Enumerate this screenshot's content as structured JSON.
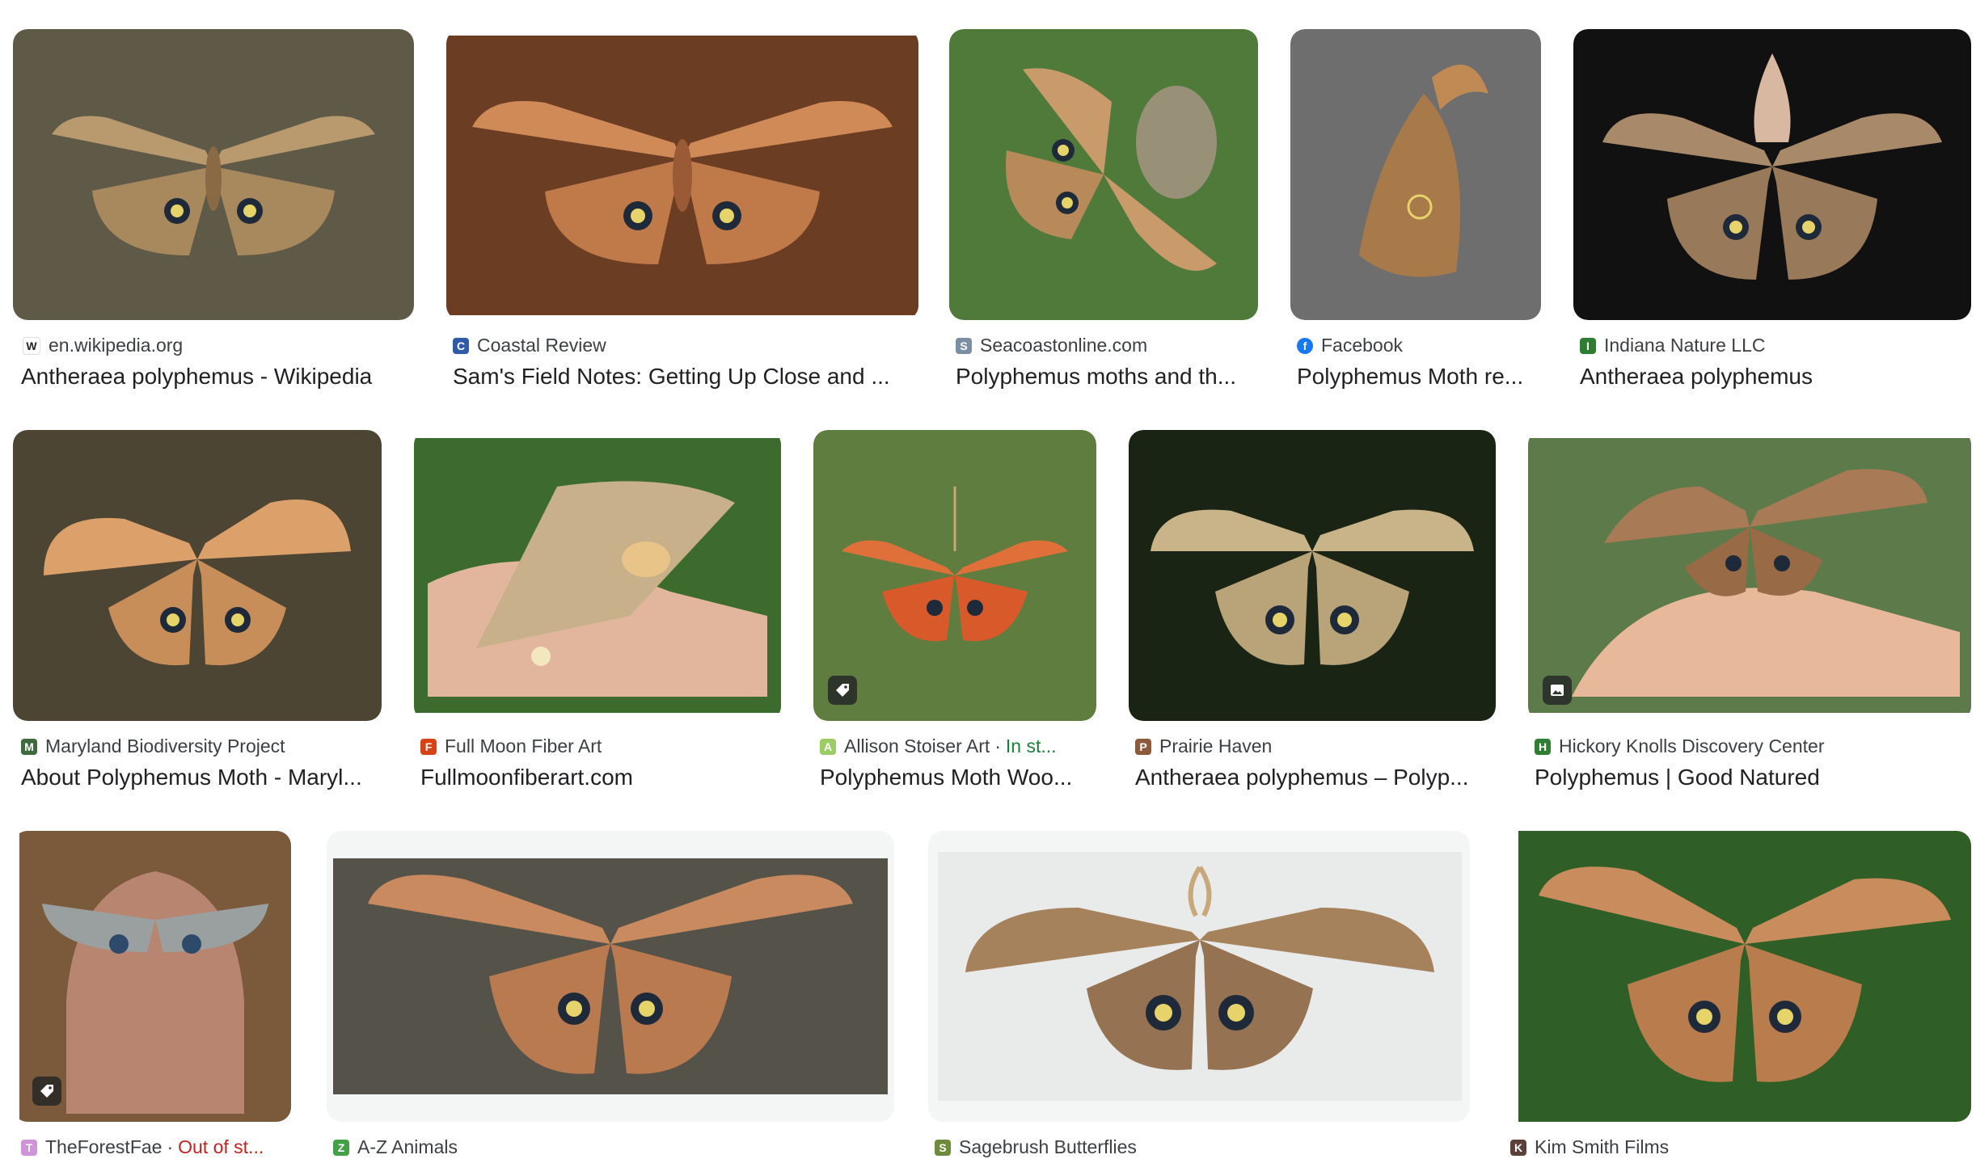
{
  "results": [
    {
      "source": "en.wikipedia.org",
      "title": "Antheraea polyphemus - Wikipedia",
      "favicon": "wikipedia-icon",
      "bg": "#5f5a48",
      "wing": "#b89a6e"
    },
    {
      "source": "Coastal Review",
      "title": "Sam's Field Notes: Getting Up Close and ...",
      "favicon": "coastal-review-icon",
      "bg": "#6b3d22",
      "wing": "#d08a58"
    },
    {
      "source": "Seacoastonline.com",
      "title": "Polyphemus moths and th...",
      "favicon": "seacoast-icon",
      "bg": "#4f7a3a",
      "wing": "#c99a6a"
    },
    {
      "source": "Facebook",
      "title": "Polyphemus Moth re...",
      "favicon": "facebook-icon",
      "bg": "#6e6e6e",
      "wing": "#a87a4a"
    },
    {
      "source": "Indiana Nature LLC",
      "title": "Antheraea polyphemus",
      "favicon": "indiana-nature-icon",
      "bg": "#111111",
      "wing": "#a8896a"
    },
    {
      "source": "Maryland Biodiversity Project",
      "title": "About Polyphemus Moth - Maryl...",
      "favicon": "maryland-biodiversity-icon",
      "bg": "#4d4533",
      "wing": "#dca06a"
    },
    {
      "source": "Full Moon Fiber Art",
      "title": "Fullmoonfiberart.com",
      "favicon": "full-moon-fiber-icon",
      "bg": "#3d6b2e",
      "wing": "#c8b08a"
    },
    {
      "source": "Allison Stoiser Art",
      "stock": "In st...",
      "title": "Polyphemus Moth Woo...",
      "favicon": "allison-stoiser-icon",
      "bg": "#5e7d3f",
      "wing": "#e0703a",
      "tagged": true
    },
    {
      "source": "Prairie Haven",
      "title": "Antheraea polyphemus – Polyp...",
      "favicon": "prairie-haven-icon",
      "bg": "#1a2414",
      "wing": "#c9b48a"
    },
    {
      "source": "Hickory Knolls Discovery Center",
      "title": "Polyphemus | Good Natured",
      "favicon": "hickory-knolls-icon",
      "bg": "#5d7a4a",
      "wing": "#a87a55",
      "image_badge": true
    },
    {
      "source": "TheForestFae",
      "stock": "Out of st...",
      "title": "",
      "favicon": "forest-fae-icon",
      "bg": "#7a5a3a",
      "wing": "#9aa0a0",
      "tagged": true
    },
    {
      "source": "A-Z Animals",
      "title": "",
      "favicon": "az-animals-icon",
      "bg": "#55524a",
      "wing": "#c88a5e"
    },
    {
      "source": "Sagebrush Butterflies",
      "title": "",
      "favicon": "sagebrush-icon",
      "bg": "#e9eaea",
      "wing": "#a5825c"
    },
    {
      "source": "Kim Smith Films",
      "title": "",
      "favicon": "kim-smith-icon",
      "bg": "#2f5f27",
      "wing": "#c98c5c"
    }
  ],
  "colors": {
    "wikipedia": "#222222",
    "coastal": "#2f5aa8",
    "seacoast": "#7a8fa6",
    "facebook": "#1877f2",
    "indiana": "#2e7d32",
    "maryland": "#3d6b3d",
    "fullmoon": "#d84315",
    "allison": "#9ccc65",
    "prairie": "#8d5a3b",
    "hickory": "#2e7d32",
    "forestfae": "#ce93d8",
    "azanimals": "#43a047",
    "sagebrush": "#6d8b3a",
    "kimsmith": "#5d4037"
  }
}
